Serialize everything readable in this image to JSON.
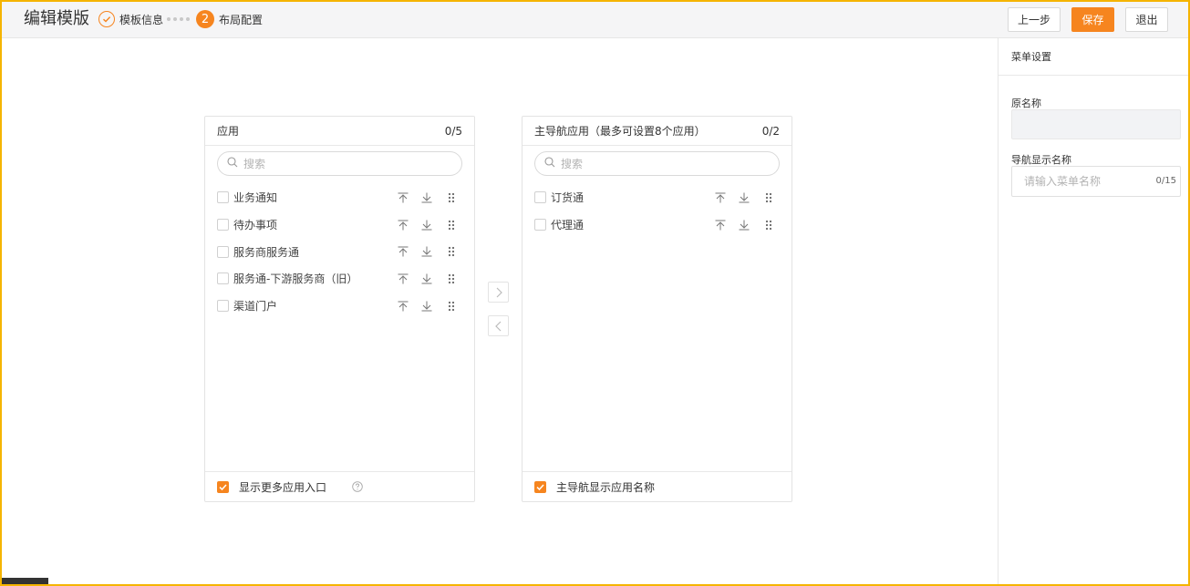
{
  "header": {
    "title": "编辑模版",
    "steps": [
      {
        "label": "模板信息",
        "state": "done"
      },
      {
        "number": "2",
        "label": "布局配置",
        "state": "active"
      }
    ],
    "buttons": {
      "prev": "上一步",
      "save": "保存",
      "exit": "退出"
    }
  },
  "left_panel": {
    "title": "应用",
    "count": "0/5",
    "search_placeholder": "搜索",
    "items": [
      {
        "label": "业务通知"
      },
      {
        "label": "待办事项"
      },
      {
        "label": "服务商服务通"
      },
      {
        "label": "服务通-下游服务商（旧）"
      },
      {
        "label": "渠道门户"
      }
    ],
    "footer_label": "显示更多应用入口"
  },
  "right_panel": {
    "title": "主导航应用（最多可设置8个应用）",
    "count": "0/2",
    "search_placeholder": "搜索",
    "items": [
      {
        "label": "订货通"
      },
      {
        "label": "代理通"
      }
    ],
    "footer_label": "主导航显示应用名称"
  },
  "settings": {
    "title": "菜单设置",
    "original_name_label": "原名称",
    "original_name_value": "",
    "display_name_label": "导航显示名称",
    "display_name_placeholder": "请输入菜单名称",
    "display_name_count": "0/15"
  },
  "colors": {
    "accent": "#f6851f",
    "border": "#e3e3e3",
    "frame": "#f5b400"
  },
  "icons": [
    "check-circle-icon",
    "search-icon",
    "move-to-top-icon",
    "move-down-icon",
    "drag-handle-icon",
    "chevron-right-icon",
    "chevron-left-icon",
    "help-circle-icon",
    "checkmark-icon"
  ]
}
